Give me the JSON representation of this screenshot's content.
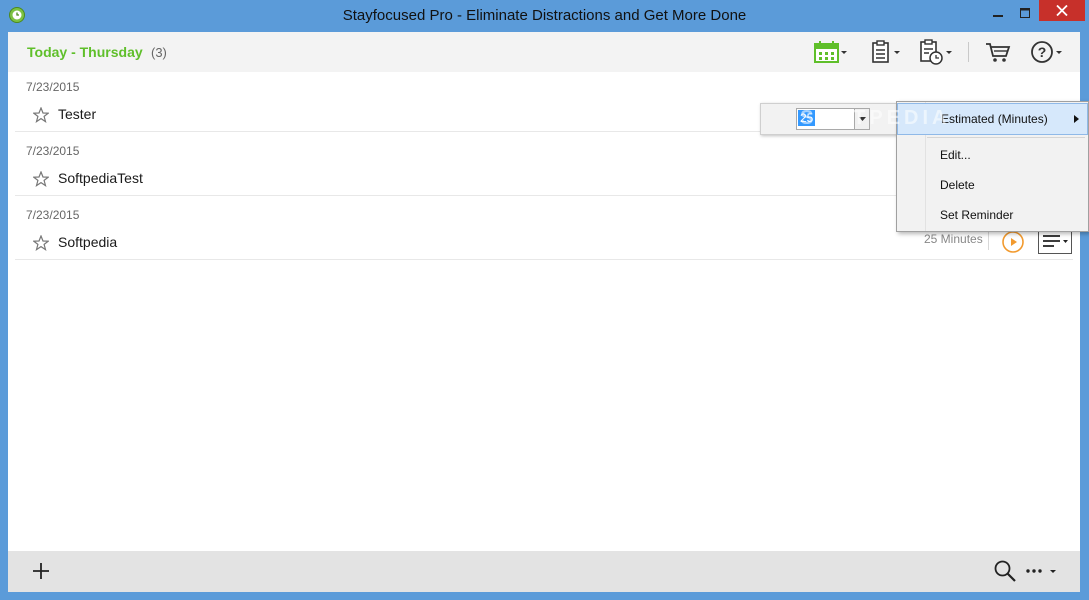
{
  "window": {
    "title": "Stayfocused Pro - Eliminate Distractions and Get More Done",
    "close_color": "#c7302a",
    "frame_color": "#5b9bd9"
  },
  "header": {
    "day_label": "Today - Thursday",
    "count": "(3)",
    "accent_color": "#5fbf2a",
    "toolbar_icons": [
      "calendar-icon",
      "clipboard-icon",
      "scheduled-clipboard-icon",
      "cart-icon",
      "help-icon"
    ]
  },
  "tasks": [
    {
      "date": "7/23/2015",
      "name": "Tester"
    },
    {
      "date": "7/23/2015",
      "name": "SoftpediaTest"
    },
    {
      "date": "7/23/2015",
      "name": "Softpedia",
      "estimate": "25 Minutes"
    }
  ],
  "estimate_popup": {
    "value": "25"
  },
  "context_menu": {
    "items": [
      "Estimated (Minutes)",
      "Edit...",
      "Delete",
      "Set Reminder"
    ]
  },
  "watermark": "SOFTPEDIA",
  "footer": {
    "icons": [
      "add-icon",
      "search-icon",
      "more-icon"
    ]
  }
}
